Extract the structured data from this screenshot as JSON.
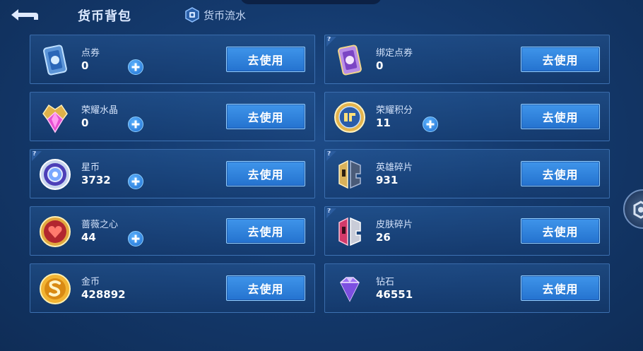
{
  "header": {
    "title": "货币背包",
    "flow_tab": "货币流水"
  },
  "cards": [
    {
      "name": "点券",
      "count": "0",
      "button": "去使用",
      "icon": "coupon-card-icon",
      "plus": true,
      "help": false
    },
    {
      "name": "绑定点券",
      "count": "0",
      "button": "去使用",
      "icon": "bound-coupon-card-icon",
      "plus": false,
      "help": true
    },
    {
      "name": "荣耀水晶",
      "count": "0",
      "button": "去使用",
      "icon": "glory-crystal-icon",
      "plus": true,
      "help": false
    },
    {
      "name": "荣耀积分",
      "count": "11",
      "button": "去使用",
      "icon": "glory-points-icon",
      "plus": true,
      "help": false
    },
    {
      "name": "星币",
      "count": "3732",
      "button": "去使用",
      "icon": "star-coin-icon",
      "plus": true,
      "help": true
    },
    {
      "name": "英雄碎片",
      "count": "931",
      "button": "去使用",
      "icon": "hero-fragment-icon",
      "plus": false,
      "help": true
    },
    {
      "name": "蔷薇之心",
      "count": "44",
      "button": "去使用",
      "icon": "rose-heart-icon",
      "plus": true,
      "help": false
    },
    {
      "name": "皮肤碎片",
      "count": "26",
      "button": "去使用",
      "icon": "skin-fragment-icon",
      "plus": false,
      "help": true
    },
    {
      "name": "金币",
      "count": "428892",
      "button": "去使用",
      "icon": "gold-coin-icon",
      "plus": false,
      "help": false
    },
    {
      "name": "钻石",
      "count": "46551",
      "button": "去使用",
      "icon": "diamond-icon",
      "plus": false,
      "help": false
    }
  ],
  "colors": {
    "background": "#143a6e",
    "button": "#2f84de",
    "accent": "#8fd0ff"
  }
}
